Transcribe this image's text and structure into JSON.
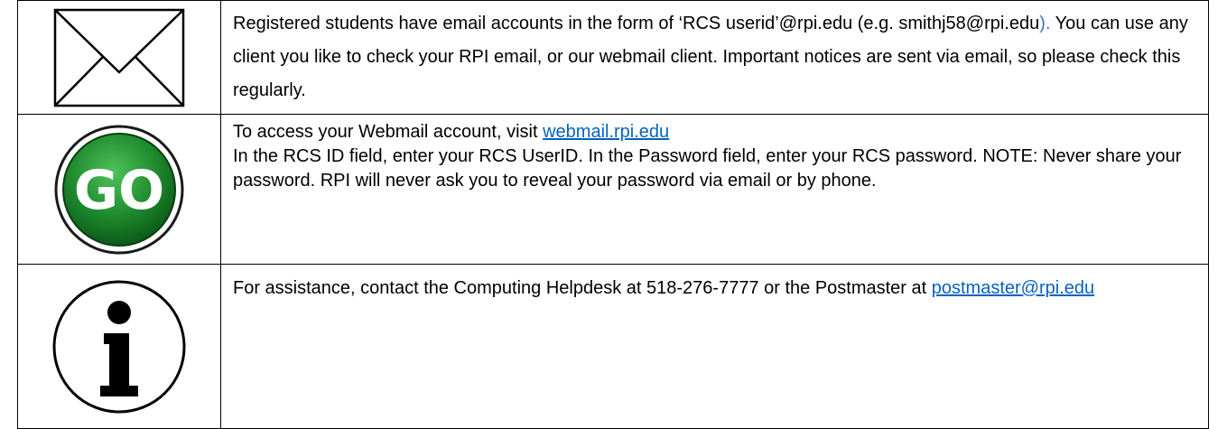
{
  "rows": {
    "email": {
      "icon": "envelope-icon",
      "text_1": "Registered students have email accounts in the form of ‘RCS userid’@rpi.edu (e.g. smithj58@rpi.edu",
      "text_paren": ").",
      "text_2": "  You can use any client you like to check your RPI email, or our webmail client.  Important notices are sent via email, so please check this regularly."
    },
    "go": {
      "icon": "go-button-icon",
      "icon_label": "GO",
      "line_1": "To access your Webmail account, visit ",
      "link": "webmail.rpi.edu",
      "text_2": "In the RCS ID field, enter your RCS UserID. In the Password field, enter your RCS password. NOTE: Never share your password. RPI will never ask you to reveal your password via email or by phone."
    },
    "info": {
      "icon": "info-icon",
      "text": "For assistance, contact the Computing Helpdesk at 518-276-7777 or the Postmaster at ",
      "link": "postmaster@rpi.edu"
    }
  },
  "colors": {
    "go_green": "#1e8a2e",
    "link": "#0563c1",
    "accent": "#4472c4"
  }
}
